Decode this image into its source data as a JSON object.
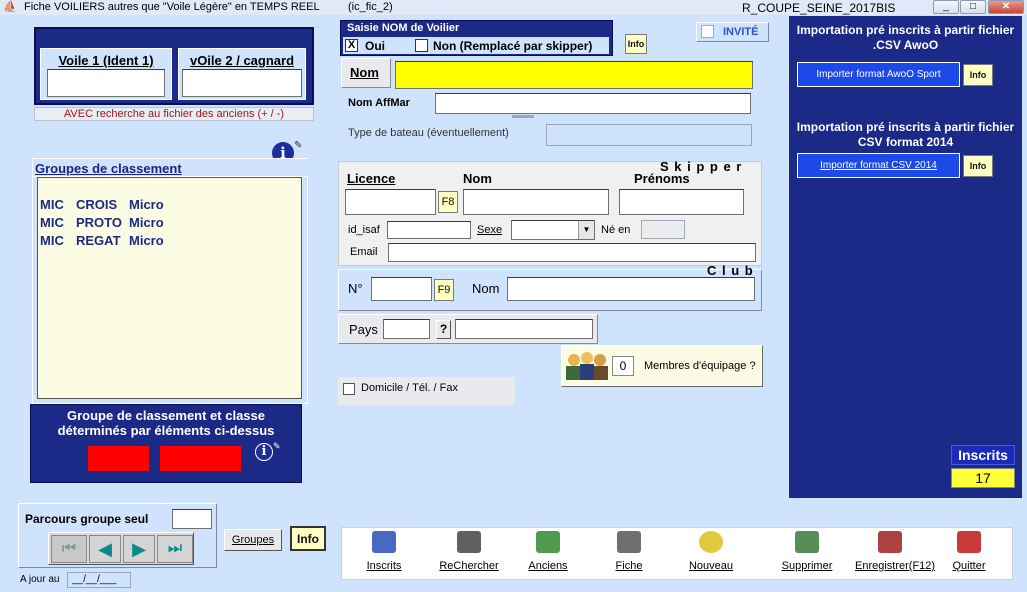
{
  "window": {
    "title": "Fiche VOILIERS autres que \"Voile Légère\"  en TEMPS REEL",
    "code": "(ic_fic_2)",
    "regatta_name": "R_COUPE_SEINE_2017BIS",
    "controls": {
      "minimize": "_",
      "maximize": "□",
      "close": "✕"
    }
  },
  "voile": {
    "voile1_label": "Voile 1 (Ident 1)",
    "voile2_label": "vOile 2 / cagnard",
    "voile1_value": "",
    "voile2_value": "",
    "search_hint": "AVEC recherche au fichier des anciens (+ / -)"
  },
  "groupes": {
    "header": "Groupes de classement",
    "items": [
      {
        "a": "MIC",
        "b": "CROIS",
        "c": "Micro"
      },
      {
        "a": "MIC",
        "b": "PROTO",
        "c": "Micro"
      },
      {
        "a": "MIC",
        "b": "REGAT",
        "c": "Micro"
      }
    ]
  },
  "classement": {
    "text_line1": "Groupe de classement  et classe",
    "text_line2": "déterminés par éléments ci-dessus",
    "group_value": "",
    "class_value": ""
  },
  "saisie": {
    "header": "Saisie NOM de Voilier",
    "oui_label": "Oui",
    "non_label": "Non (Remplacé par skipper)",
    "oui_checked": true,
    "invite_label": "INVITÉ"
  },
  "boat": {
    "nom_label": "Nom",
    "nom_value": "",
    "nom_affmar_label": "Nom AffMar",
    "nom_affmar_value": "",
    "type_label": "Type de bateau (éventuellement)",
    "type_value": ""
  },
  "skipper": {
    "header": "S k i p p e r",
    "licence_label": "Licence",
    "f8_label": "F8",
    "nom_label": "Nom",
    "prenoms_label": "Prénoms",
    "id_isaf_label": "id_isaf",
    "sexe_label": "Sexe",
    "ne_en_label": "Né en",
    "email_label": "Email"
  },
  "club": {
    "header": "C l u b",
    "num_label": "N°",
    "f9_label": "F9",
    "nom_label": "Nom"
  },
  "pays": {
    "label": "Pays",
    "help_label": "?"
  },
  "equipage": {
    "count": "0",
    "label": "Membres d'équipage  ?"
  },
  "domicile": {
    "label": "Domicile / Tél. / Fax"
  },
  "import": {
    "title1": "Importation pré inscrits à partir fichier .CSV AwoO",
    "btn1": "Importer format AwoO Sport",
    "title2": "Importation pré inscrits à partir fichier CSV format 2014",
    "btn2": "Importer format CSV 2014",
    "info_label": "Info"
  },
  "inscrits": {
    "label": "Inscrits",
    "count": "17"
  },
  "parcours": {
    "label": "Parcours groupe seul",
    "value": "",
    "groupes_btn": "Groupes",
    "info_btn": "Info",
    "ajour_label": "A jour au",
    "ajour_value": "__/__/___"
  },
  "toolbar": [
    {
      "name": "inscrits-button",
      "label": "Inscrits",
      "icon": "list-icon"
    },
    {
      "name": "rechercher-button",
      "label": "ReChercher",
      "icon": "search-person-icon"
    },
    {
      "name": "anciens-button",
      "label": "Anciens",
      "icon": "dinosaur-icon"
    },
    {
      "name": "fiche-button",
      "label": "Fiche",
      "icon": "printer-icon"
    },
    {
      "name": "nouveau-button",
      "label": "Nouveau",
      "icon": "new-chick-icon"
    },
    {
      "name": "supprimer-button",
      "label": "Supprimer",
      "icon": "trash-icon"
    },
    {
      "name": "enregistrer-button",
      "label": "Enregistrer(F12)",
      "icon": "save-icon"
    },
    {
      "name": "quitter-button",
      "label": "Quitter",
      "icon": "exit-icon"
    }
  ]
}
